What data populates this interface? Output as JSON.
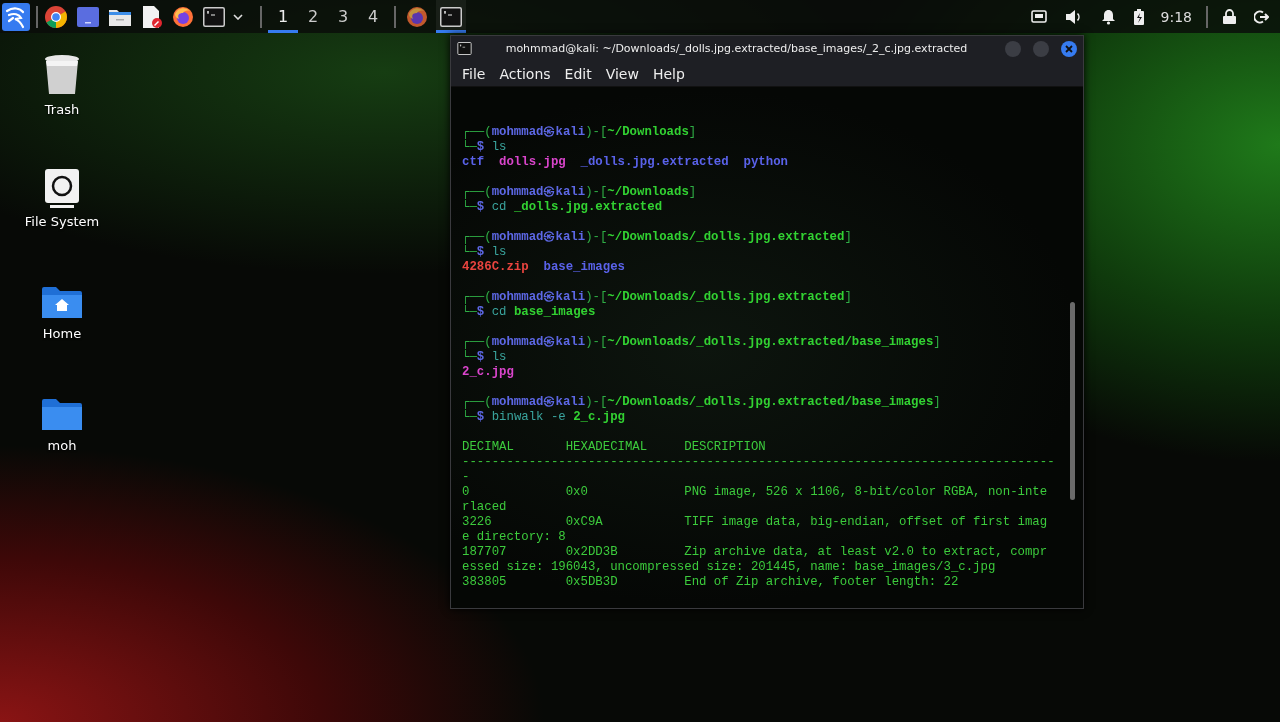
{
  "taskbar": {
    "launchers": [
      {
        "kind": "kali"
      },
      {
        "kind": "chrome"
      },
      {
        "kind": "window"
      },
      {
        "kind": "files"
      },
      {
        "kind": "editor"
      },
      {
        "kind": "firefox"
      },
      {
        "kind": "terminal"
      },
      {
        "kind": "caret"
      }
    ],
    "workspaces": [
      {
        "label": "1",
        "selected": true
      },
      {
        "label": "2",
        "selected": false
      },
      {
        "label": "3",
        "selected": false
      },
      {
        "label": "4",
        "selected": false
      }
    ],
    "tasks": [
      {
        "kind": "firefox",
        "selected": false
      },
      {
        "kind": "terminal",
        "selected": true
      }
    ],
    "tray": [
      {
        "kind": "network"
      },
      {
        "kind": "volume"
      },
      {
        "kind": "bell"
      },
      {
        "kind": "battery"
      },
      {
        "kind": "clock",
        "text": "9:18"
      },
      {
        "kind": "lock"
      },
      {
        "kind": "logout"
      }
    ]
  },
  "desktop_icons": [
    {
      "label": "Trash",
      "kind": "trash"
    },
    {
      "label": "File System",
      "kind": "drive"
    },
    {
      "label": "Home",
      "kind": "home"
    },
    {
      "label": "moh",
      "kind": "folder"
    }
  ],
  "terminal": {
    "title": "mohmmad@kali: ~/Downloads/_dolls.jpg.extracted/base_images/_2_c.jpg.extracted",
    "menu": [
      "File",
      "Actions",
      "Edit",
      "View",
      "Help"
    ],
    "blocks": [
      {
        "lines": [
          {
            "segments": [
              {
                "text": "┌──(",
                "kind": "frame"
              },
              {
                "text": "mohmmad㉿kali",
                "kind": "user"
              },
              {
                "text": ")-[",
                "kind": "frame"
              },
              {
                "text": "~/Downloads",
                "kind": "path"
              },
              {
                "text": "]",
                "kind": "frame"
              }
            ]
          },
          {
            "segments": [
              {
                "text": "└─",
                "kind": "frame"
              },
              {
                "text": "$ ",
                "kind": "dollar"
              },
              {
                "text": "ls",
                "kind": "command"
              }
            ]
          },
          {
            "segments": [
              {
                "text": "ctf  ",
                "kind": "dir"
              },
              {
                "text": "dolls.jpg  ",
                "kind": "image"
              },
              {
                "text": "_dolls.jpg.extracted  python",
                "kind": "dir"
              }
            ]
          }
        ]
      },
      {
        "lines": [
          {
            "segments": [
              {
                "text": "┌──(",
                "kind": "frame"
              },
              {
                "text": "mohmmad㉿kali",
                "kind": "user"
              },
              {
                "text": ")-[",
                "kind": "frame"
              },
              {
                "text": "~/Downloads",
                "kind": "path"
              },
              {
                "text": "]",
                "kind": "frame"
              }
            ]
          },
          {
            "segments": [
              {
                "text": "└─",
                "kind": "frame"
              },
              {
                "text": "$ ",
                "kind": "dollar"
              },
              {
                "text": "cd ",
                "kind": "command"
              },
              {
                "text": "_dolls.jpg.extracted",
                "kind": "argument"
              }
            ]
          }
        ]
      },
      {
        "lines": [
          {
            "segments": [
              {
                "text": "┌──(",
                "kind": "frame"
              },
              {
                "text": "mohmmad㉿kali",
                "kind": "user"
              },
              {
                "text": ")-[",
                "kind": "frame"
              },
              {
                "text": "~/Downloads/_dolls.jpg.extracted",
                "kind": "path"
              },
              {
                "text": "]",
                "kind": "frame"
              }
            ]
          },
          {
            "segments": [
              {
                "text": "└─",
                "kind": "frame"
              },
              {
                "text": "$ ",
                "kind": "dollar"
              },
              {
                "text": "ls",
                "kind": "command"
              }
            ]
          },
          {
            "segments": [
              {
                "text": "4286C.zip  ",
                "kind": "archive"
              },
              {
                "text": "base_images",
                "kind": "dir"
              }
            ]
          }
        ]
      },
      {
        "lines": [
          {
            "segments": [
              {
                "text": "┌──(",
                "kind": "frame"
              },
              {
                "text": "mohmmad㉿kali",
                "kind": "user"
              },
              {
                "text": ")-[",
                "kind": "frame"
              },
              {
                "text": "~/Downloads/_dolls.jpg.extracted",
                "kind": "path"
              },
              {
                "text": "]",
                "kind": "frame"
              }
            ]
          },
          {
            "segments": [
              {
                "text": "└─",
                "kind": "frame"
              },
              {
                "text": "$ ",
                "kind": "dollar"
              },
              {
                "text": "cd ",
                "kind": "command"
              },
              {
                "text": "base_images",
                "kind": "argument"
              }
            ]
          }
        ]
      },
      {
        "lines": [
          {
            "segments": [
              {
                "text": "┌──(",
                "kind": "frame"
              },
              {
                "text": "mohmmad㉿kali",
                "kind": "user"
              },
              {
                "text": ")-[",
                "kind": "frame"
              },
              {
                "text": "~/Downloads/_dolls.jpg.extracted/base_images",
                "kind": "path"
              },
              {
                "text": "]",
                "kind": "frame"
              }
            ]
          },
          {
            "segments": [
              {
                "text": "└─",
                "kind": "frame"
              },
              {
                "text": "$ ",
                "kind": "dollar"
              },
              {
                "text": "ls",
                "kind": "command"
              }
            ]
          },
          {
            "segments": [
              {
                "text": "2_c.jpg",
                "kind": "image"
              }
            ]
          }
        ]
      },
      {
        "lines": [
          {
            "segments": [
              {
                "text": "┌──(",
                "kind": "frame"
              },
              {
                "text": "mohmmad㉿kali",
                "kind": "user"
              },
              {
                "text": ")-[",
                "kind": "frame"
              },
              {
                "text": "~/Downloads/_dolls.jpg.extracted/base_images",
                "kind": "path"
              },
              {
                "text": "]",
                "kind": "frame"
              }
            ]
          },
          {
            "segments": [
              {
                "text": "└─",
                "kind": "frame"
              },
              {
                "text": "$ ",
                "kind": "dollar"
              },
              {
                "text": "binwalk -e ",
                "kind": "command"
              },
              {
                "text": "2_c.jpg",
                "kind": "argument"
              }
            ]
          }
        ]
      },
      {
        "lines": [
          {
            "segments": [
              {
                "text": "DECIMAL       HEXADECIMAL     DESCRIPTION",
                "kind": "output"
              }
            ]
          },
          {
            "segments": [
              {
                "text": "--------------------------------------------------------------------------------",
                "kind": "output"
              }
            ]
          },
          {
            "segments": [
              {
                "text": "-",
                "kind": "output"
              }
            ]
          },
          {
            "segments": [
              {
                "text": "0             0x0             PNG image, 526 x 1106, 8-bit/color RGBA, non-inte",
                "kind": "output"
              }
            ]
          },
          {
            "segments": [
              {
                "text": "rlaced",
                "kind": "output"
              }
            ]
          },
          {
            "segments": [
              {
                "text": "3226          0xC9A           TIFF image data, big-endian, offset of first imag",
                "kind": "output"
              }
            ]
          },
          {
            "segments": [
              {
                "text": "e directory: 8",
                "kind": "output"
              }
            ]
          },
          {
            "segments": [
              {
                "text": "187707        0x2DD3B         Zip archive data, at least v2.0 to extract, compr",
                "kind": "output"
              }
            ]
          },
          {
            "segments": [
              {
                "text": "essed size: 196043, uncompressed size: 201445, name: base_images/3_c.jpg",
                "kind": "output"
              }
            ]
          },
          {
            "segments": [
              {
                "text": "383805        0x5DB3D         End of Zip archive, footer length: 22",
                "kind": "output"
              }
            ]
          }
        ]
      }
    ]
  }
}
